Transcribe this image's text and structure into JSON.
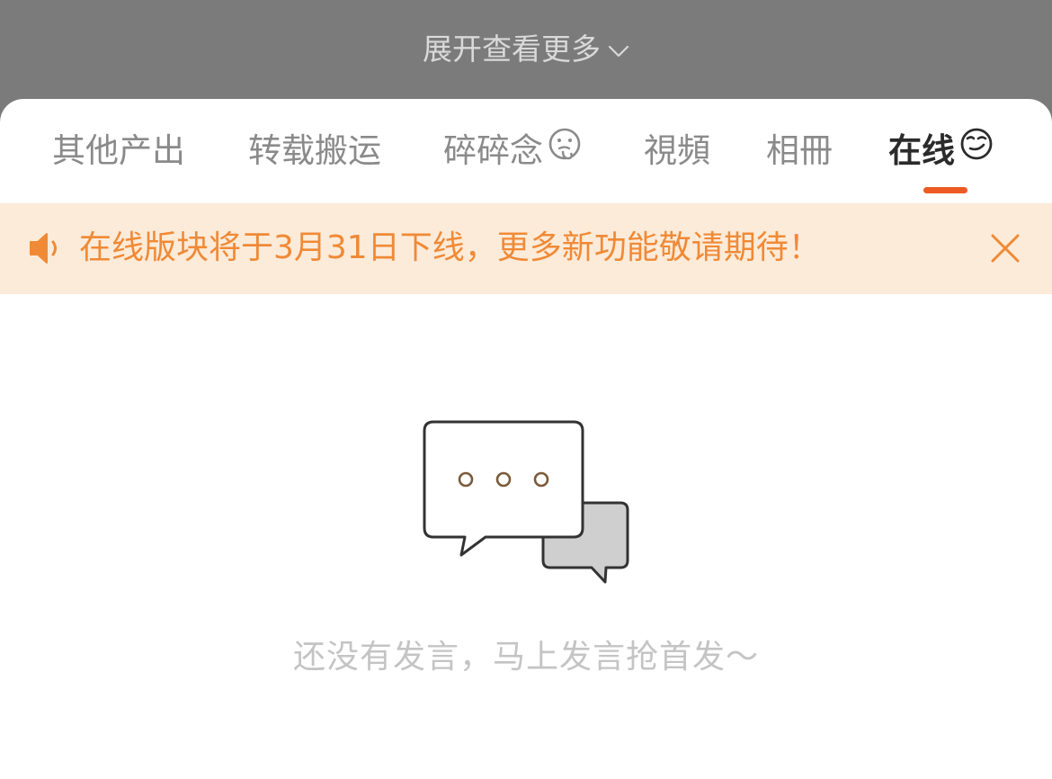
{
  "header": {
    "expand_label": "展开查看更多",
    "expand_icon": "chevron-down-icon"
  },
  "tabs": [
    {
      "label": "其他产出",
      "active": false
    },
    {
      "label": "转载搬运",
      "active": false
    },
    {
      "label": "碎碎念",
      "active": false,
      "icon": "thinking-face-icon"
    },
    {
      "label": "視頻",
      "active": false
    },
    {
      "label": "相冊",
      "active": false
    },
    {
      "label": "在线",
      "active": true,
      "icon": "smirk-face-icon"
    }
  ],
  "notice": {
    "icon": "speaker-icon",
    "text": "在线版块将于3月31日下线，更多新功能敬请期待！",
    "close_icon": "close-icon",
    "color": "#f08a36",
    "background": "#fcebd9"
  },
  "empty_state": {
    "icon": "chat-bubbles-icon",
    "message": "还没有发言，马上发言抢首发～"
  },
  "colors": {
    "accent": "#ee5a24",
    "overlay": "#7b7b7b"
  }
}
